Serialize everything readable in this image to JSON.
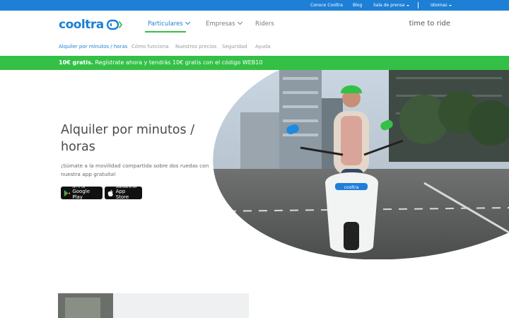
{
  "topbar": {
    "links": [
      "Conoce Cooltra",
      "Blog",
      "Sala de prensa",
      "Idiomas"
    ]
  },
  "header": {
    "logo": "cooltra",
    "nav": [
      "Particulares",
      "Empresas",
      "Riders"
    ],
    "tagline": "time to ride"
  },
  "subnav": {
    "items": [
      "Alquiler por minutos / horas",
      "Cómo funciona",
      "Nuestros precios",
      "Seguridad",
      "Ayuda"
    ]
  },
  "promo": {
    "bold": "10€ gratis.",
    "text": " Regístrate ahora y tendrás 10€ gratis con el código WEB10"
  },
  "hero": {
    "title": "Alquiler por minutos / horas",
    "description": "¡Súmate a la movilidad compartida sobre dos ruedas con nuestra app gratuita!",
    "google_play": {
      "small": "GET IT ON",
      "big": "Google Play"
    },
    "app_store": {
      "small": "Download on the",
      "big": "App Store"
    },
    "scooter_plate": "cooltra"
  },
  "colors": {
    "brand_blue": "#1d7fd6",
    "brand_green": "#34c046"
  }
}
